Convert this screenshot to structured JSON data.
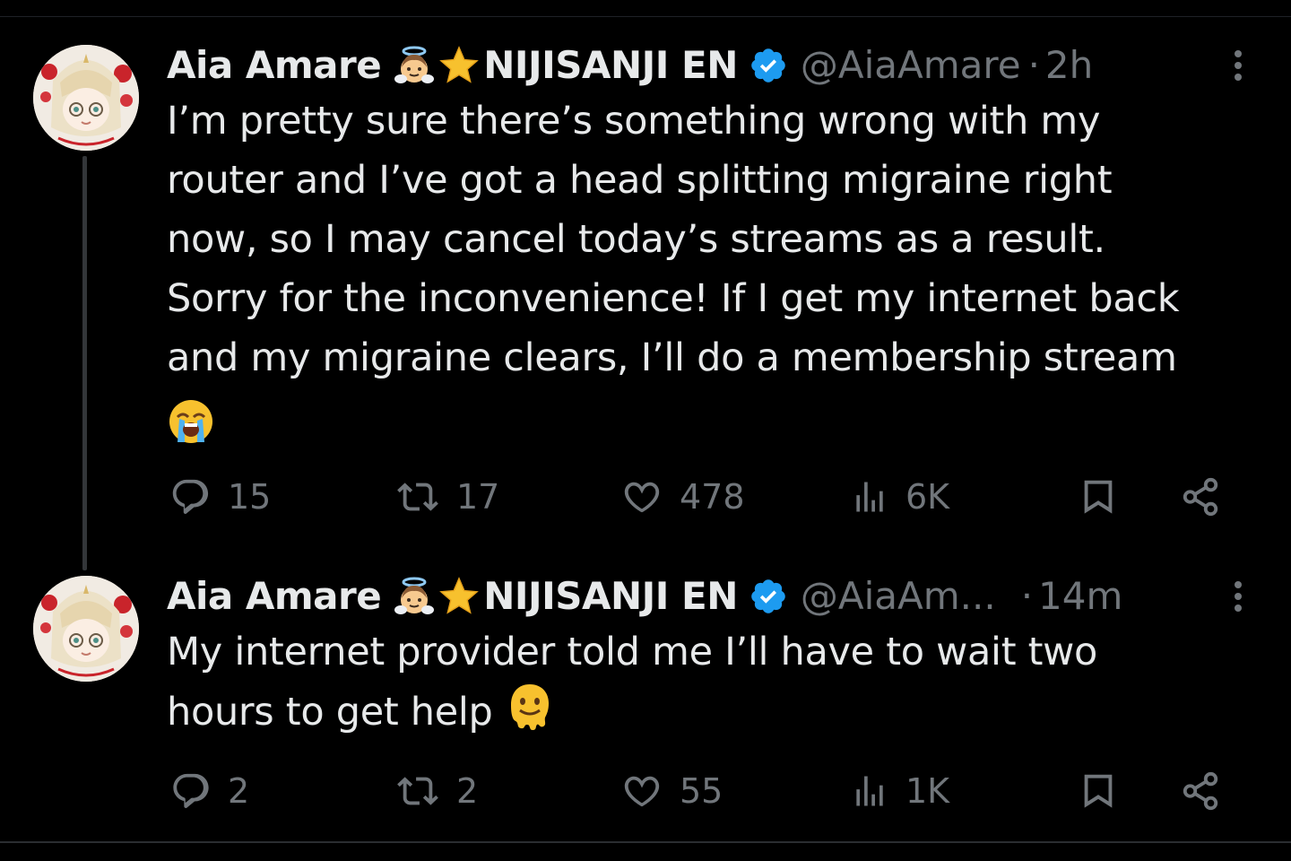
{
  "thread": [
    {
      "author": {
        "display_name": "Aia Amare",
        "name_suffix": "NIJISANJI EN",
        "handle": "@AiaAmare",
        "verified": true
      },
      "separator": "·",
      "time": "2h",
      "text_lines": [
        "I’m pretty sure there’s something wrong with my",
        "router and I’ve got a head splitting migraine right",
        "now, so I may cancel today’s streams as a result.",
        "Sorry for the inconvenience! If I get my internet back",
        "and my migraine clears, I’ll do a membership stream"
      ],
      "trailing_emoji": "loudly-crying-face",
      "stats": {
        "replies": "15",
        "retweets": "17",
        "likes": "478",
        "views": "6K"
      }
    },
    {
      "author": {
        "display_name": "Aia Amare",
        "name_suffix": "NIJISANJI EN",
        "handle": "@AiaAm...",
        "verified": true
      },
      "separator": "·",
      "time": "14m",
      "text_lines": [
        "My internet provider told me I’ll have to wait two",
        "hours to get help"
      ],
      "trailing_emoji": "melting-face",
      "stats": {
        "replies": "2",
        "retweets": "2",
        "likes": "55",
        "views": "1K"
      }
    }
  ],
  "icons": {
    "name_emojis": [
      "angel-face-emoji",
      "star-emoji"
    ],
    "verified": "verified-badge-icon",
    "actions": [
      "reply-icon",
      "retweet-icon",
      "like-icon",
      "views-icon",
      "bookmark-icon",
      "share-icon"
    ],
    "more": "more-vertical-icon"
  },
  "colors": {
    "background": "#000000",
    "text": "#e7e9ea",
    "muted": "#71767b",
    "verified": "#1d9bf0",
    "thread_line": "#333639"
  }
}
